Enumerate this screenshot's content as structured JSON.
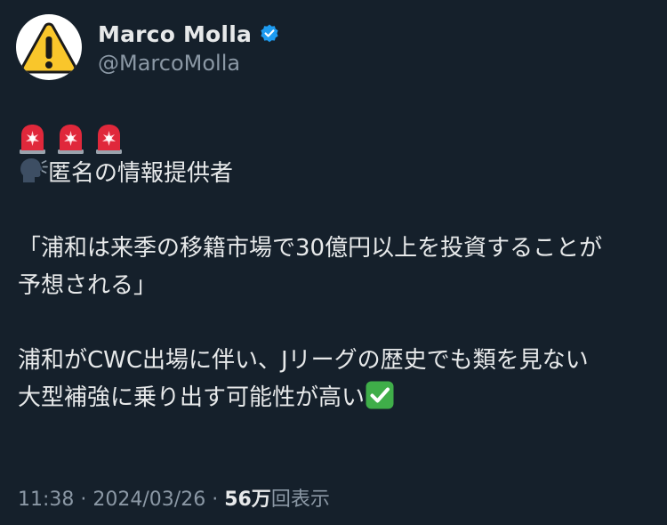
{
  "author": {
    "display_name": "Marco Molla",
    "handle": "@MarcoMolla",
    "avatar_icon": "warning-sign-icon",
    "verified_icon": "verified-badge-icon",
    "verified_color": "#1d9bf0"
  },
  "tweet": {
    "lead_icons": [
      "rotating-light-icon",
      "rotating-light-icon",
      "rotating-light-icon"
    ],
    "source_line": "匿名の情報提供者",
    "source_icon": "speaking-head-icon",
    "quote_line1": "「浦和は来季の移籍市場で30億円以上を投資することが",
    "quote_line2": "予想される」",
    "body_line1": "浦和がCWC出場に伴い、Jリーグの歴史でも類を見ない",
    "body_line2": "大型補強に乗り出す可能性が高い",
    "body_end_icon": "check-mark-button-icon"
  },
  "meta": {
    "time": "11:38",
    "separator": " · ",
    "date": "2024/03/26",
    "views_count": "56万",
    "views_label": "回表示"
  },
  "colors": {
    "background": "#15202b",
    "text_primary": "#e7e9ea",
    "text_secondary": "#8b98a5",
    "check_green": "#34a853"
  }
}
